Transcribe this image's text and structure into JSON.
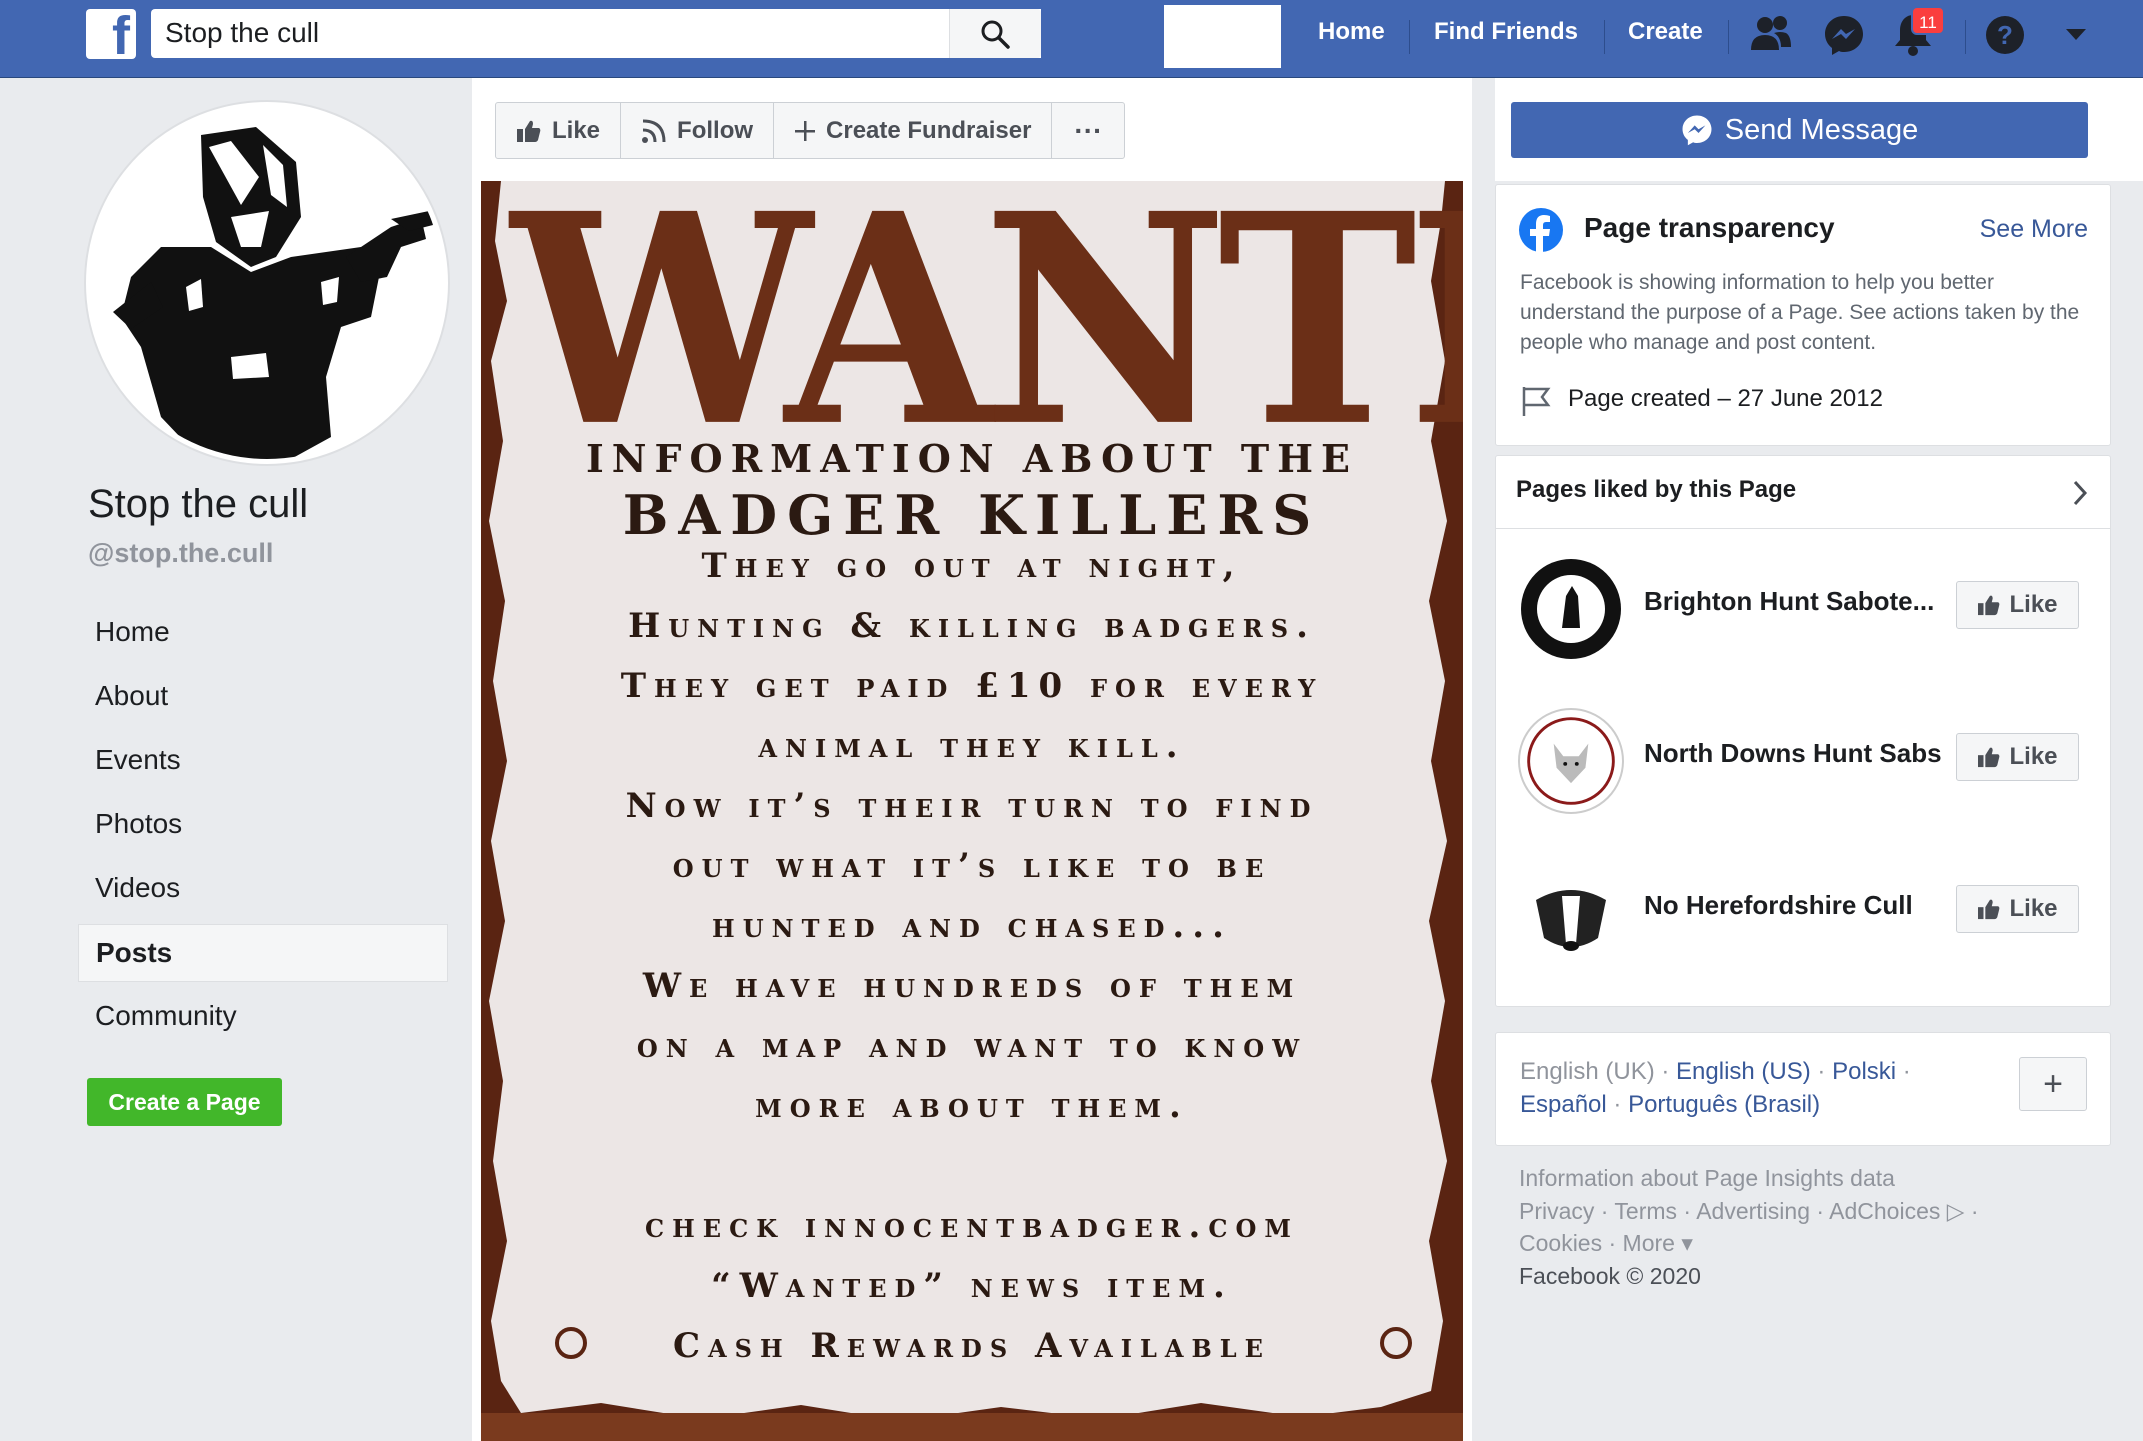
{
  "topbar": {
    "logo_letter": "f",
    "search_value": "Stop the cull",
    "nav": [
      "Home",
      "Find Friends",
      "Create"
    ],
    "notification_count": "11",
    "icons": [
      "friends-icon",
      "messenger-icon",
      "notifications-icon",
      "help-icon",
      "account-menu-icon"
    ]
  },
  "page": {
    "name": "Stop the cull",
    "handle": "@stop.the.cull",
    "nav": [
      "Home",
      "About",
      "Events",
      "Photos",
      "Videos",
      "Posts",
      "Community"
    ],
    "active_nav": "Posts",
    "create_page_label": "Create a Page"
  },
  "actions": {
    "like": "Like",
    "follow": "Follow",
    "fundraiser": "Create Fundraiser",
    "more": "···"
  },
  "poster": {
    "title": "WANTED",
    "sub1": "INFORMATION ABOUT THE",
    "sub2": "BADGER KILLERS",
    "lines": [
      "They go out at night,",
      "Hunting & killing badgers.",
      "They get paid £10 for every",
      "animal they kill.",
      "Now it’s their turn to find",
      "out what it’s like to be",
      "hunted and chased...",
      "We have hundreds of them",
      "on a map and want to know",
      "more about them.",
      "",
      "check innocentbadger.com",
      "“Wanted” news item.",
      "Cash Rewards Available"
    ]
  },
  "right": {
    "send_message": "Send Message",
    "transparency": {
      "title": "Page transparency",
      "see_more": "See More",
      "description": "Facebook is showing information to help you better understand the purpose of a Page. See actions taken by the people who manage and post content.",
      "created": "Page created – 27 June 2012"
    },
    "pages_liked": {
      "title": "Pages liked by this Page",
      "like_label": "Like",
      "items": [
        {
          "name": "Brighton Hunt Sabote..."
        },
        {
          "name": "North Downs Hunt Sabs"
        },
        {
          "name": "No Herefordshire Cull"
        }
      ]
    },
    "languages": {
      "current": "English (UK)",
      "links": [
        "English (US)",
        "Polski",
        "Español",
        "Português (Brasil)"
      ],
      "add": "+"
    },
    "footer": {
      "line1": "Information about Page Insights data",
      "line2": "Privacy · Terms · Advertising · AdChoices ▷ ·",
      "line3": "Cookies · More ▾",
      "copyright": "Facebook © 2020"
    }
  },
  "colors": {
    "brand_blue": "#4267b2",
    "create_green": "#42b72a",
    "badge_red": "#fa3e3e",
    "poster_brown": "#6b2f17",
    "link_blue": "#385898"
  }
}
